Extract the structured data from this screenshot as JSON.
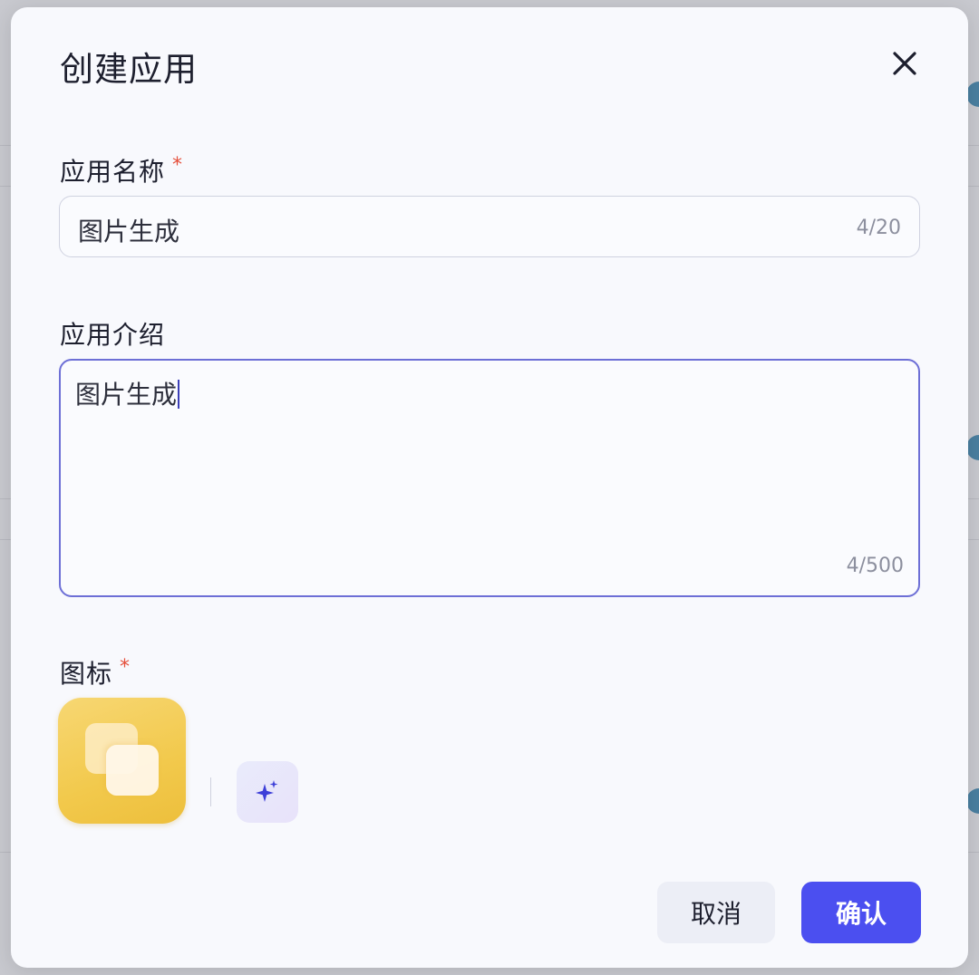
{
  "dialog": {
    "title": "创建应用",
    "close_icon": "close-icon"
  },
  "app_name": {
    "label": "应用名称",
    "required_mark": "*",
    "value": "图片生成",
    "count": "4/20"
  },
  "app_intro": {
    "label": "应用介绍",
    "value": "图片生成",
    "count": "4/500"
  },
  "icon_field": {
    "label": "图标",
    "required_mark": "*",
    "selected_icon": "layers-icon",
    "selected_icon_color": "#f2c94c",
    "ai_generate_icon": "sparkle-icon"
  },
  "actions": {
    "cancel_label": "取消",
    "confirm_label": "确认",
    "confirm_color": "#4b4ff0"
  }
}
